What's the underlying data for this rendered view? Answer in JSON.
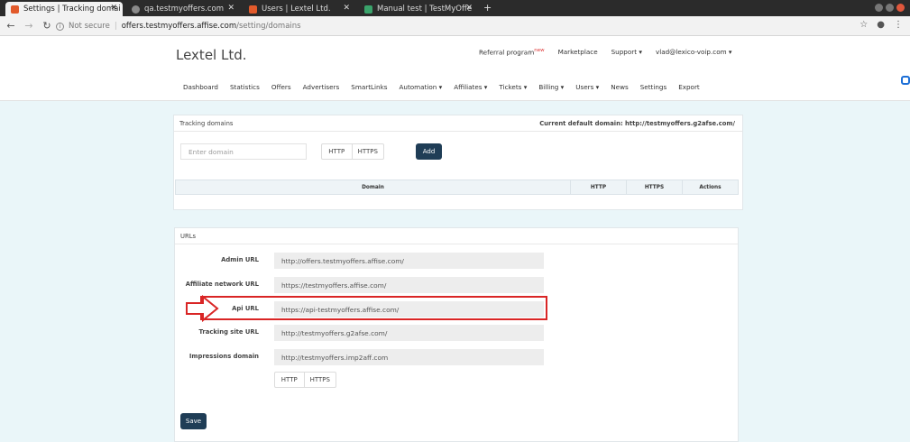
{
  "browser": {
    "tabs": [
      {
        "title": "Settings | Tracking domai",
        "active": true,
        "favicon_color": "#e25a2b"
      },
      {
        "title": "qa.testmyoffers.com",
        "active": false,
        "favicon_color": "#8a8a8a"
      },
      {
        "title": "Users | Lextel Ltd.",
        "active": false,
        "favicon_color": "#e25a2b"
      },
      {
        "title": "Manual test | TestMyOffe",
        "active": false,
        "favicon_color": "#3aa36b"
      }
    ],
    "new_tab": "+",
    "address": {
      "security": "Not secure",
      "host": "offers.testmyoffers.affise.com",
      "path": "/setting/domains"
    }
  },
  "header": {
    "brand": "Lextel Ltd.",
    "top_nav": [
      {
        "label": "Referral program",
        "badge": "new"
      },
      {
        "label": "Marketplace"
      },
      {
        "label": "Support ▾"
      },
      {
        "label": "vlad@lexico-voip.com ▾"
      }
    ],
    "main_nav": [
      "Dashboard",
      "Statistics",
      "Offers",
      "Advertisers",
      "SmartLinks",
      "Automation ▾",
      "Affiliates ▾",
      "Tickets ▾",
      "Billing ▾",
      "Users ▾",
      "News",
      "Settings",
      "Export"
    ]
  },
  "tracking": {
    "title": "Tracking domains",
    "current_default_label": "Current default domain: http://testmyoffers.g2afse.com/",
    "domain_placeholder": "Enter domain",
    "protocols": [
      "HTTP",
      "HTTPS"
    ],
    "add_label": "Add",
    "columns": [
      "Domain",
      "HTTP",
      "HTTPS",
      "Actions"
    ]
  },
  "urls": {
    "title": "URLs",
    "rows": [
      {
        "label": "Admin URL",
        "value": "http://offers.testmyoffers.affise.com/"
      },
      {
        "label": "Affiliate network URL",
        "value": "https://testmyoffers.affise.com/"
      },
      {
        "label": "Api URL",
        "value": "https://api-testmyoffers.affise.com/"
      },
      {
        "label": "Tracking site URL",
        "value": "http://testmyoffers.g2afse.com/"
      },
      {
        "label": "Impressions domain",
        "value": "http://testmyoffers.imp2aff.com"
      }
    ],
    "protocols": [
      "HTTP",
      "HTTPS"
    ],
    "save_label": "Save"
  },
  "colors": {
    "accent_dark": "#1f3d56",
    "highlight": "#d92525",
    "page_bg": "#eaf6f9"
  }
}
